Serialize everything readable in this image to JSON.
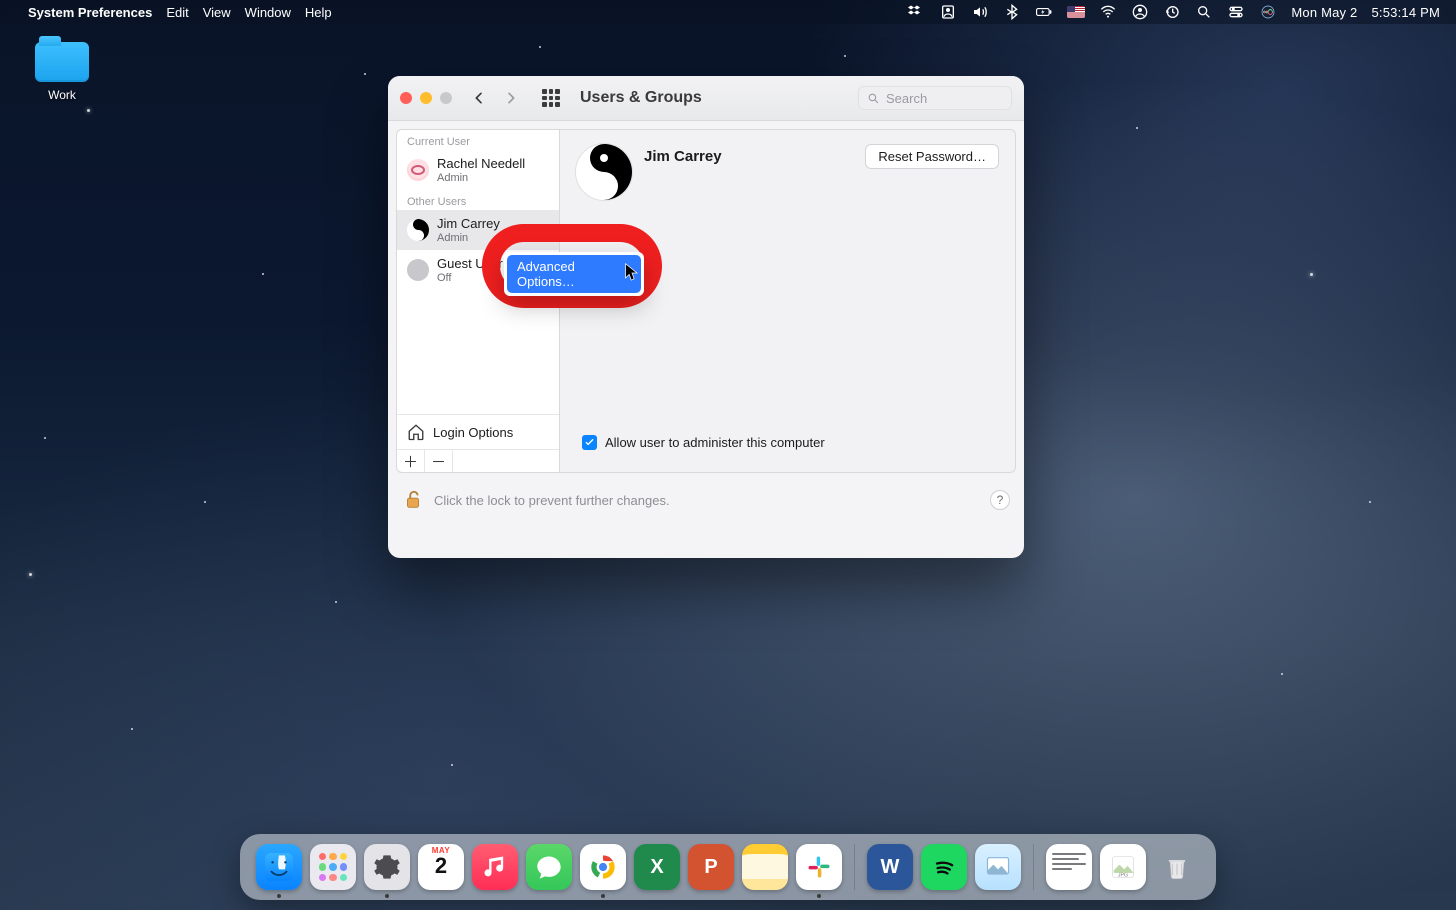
{
  "menubar": {
    "app_name": "System Preferences",
    "menus": [
      "Edit",
      "View",
      "Window",
      "Help"
    ],
    "status_icons": [
      "dropbox-icon",
      "boxed-group-icon",
      "volume-icon",
      "bluetooth-icon",
      "battery-charging-icon",
      "flag-us-icon",
      "wifi-icon",
      "user-icon",
      "clock-icon",
      "search-icon",
      "control-center-icon",
      "siri-icon"
    ],
    "date": "Mon May 2",
    "time": "5:53:14 PM"
  },
  "desktop": {
    "icons": [
      {
        "name": "work-folder",
        "label": "Work"
      }
    ]
  },
  "window": {
    "title": "Users & Groups",
    "search_placeholder": "Search",
    "sidebar": {
      "sections": [
        {
          "label": "Current User",
          "items": [
            {
              "name": "Rachel Needell",
              "sub": "Admin",
              "avatar": "face",
              "selected": false
            }
          ]
        },
        {
          "label": "Other Users",
          "items": [
            {
              "name": "Jim Carrey",
              "sub": "Admin",
              "avatar": "yinyang",
              "selected": true
            },
            {
              "name": "Guest User",
              "sub": "Off",
              "avatar": "guest",
              "selected": false
            }
          ]
        }
      ],
      "login_options_label": "Login Options"
    },
    "main": {
      "user_name": "Jim Carrey",
      "reset_button": "Reset Password…",
      "allow_admin_label": "Allow user to administer this computer",
      "allow_admin_checked": true
    },
    "lock": {
      "text": "Click the lock to prevent further changes."
    }
  },
  "context_menu": {
    "items": [
      {
        "label": "Advanced Options…",
        "highlighted": true
      }
    ]
  },
  "dock": {
    "calendar": {
      "month": "MAY",
      "day": "2"
    },
    "items_left": [
      "finder",
      "launchpad",
      "system-preferences",
      "calendar",
      "music",
      "messages",
      "chrome",
      "excel",
      "powerpoint",
      "notes",
      "slack"
    ],
    "items_right": [
      "word",
      "spotify",
      "preview"
    ],
    "items_end": [
      "downloads-text",
      "downloads-jpg",
      "trash"
    ]
  }
}
